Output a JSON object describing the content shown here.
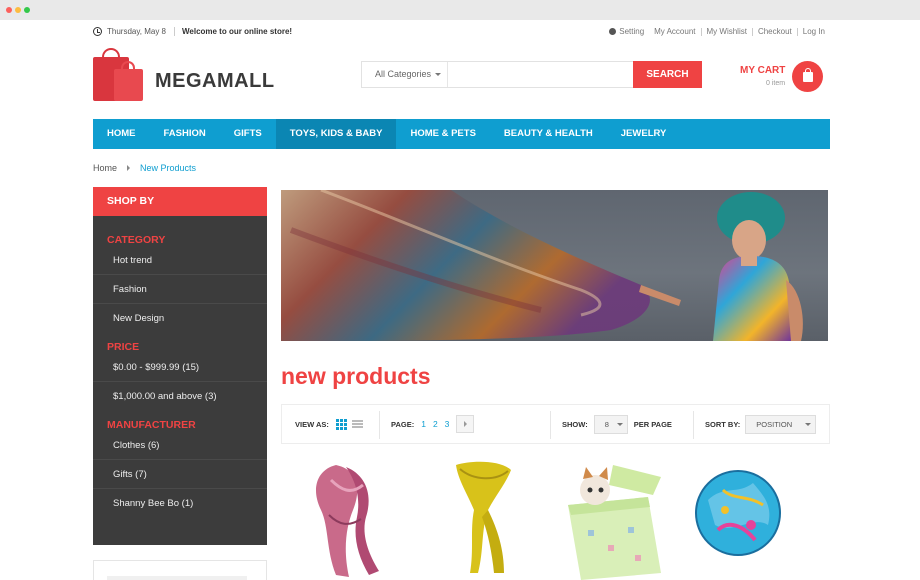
{
  "topbar": {
    "date": "Thursday, May 8",
    "welcome": "Welcome to our online store!",
    "links": [
      "Setting",
      "My Account",
      "My Wishlist",
      "Checkout",
      "Log In"
    ]
  },
  "logo": {
    "text": "MEGAMALL"
  },
  "search": {
    "category": "All Categories",
    "button": "SEARCH",
    "value": ""
  },
  "cart": {
    "label": "MY CART",
    "items": "0 item"
  },
  "nav": [
    "HOME",
    "FASHION",
    "GIFTS",
    "TOYS, KIDS & BABY",
    "HOME & PETS",
    "BEAUTY & HEALTH",
    "JEWELRY"
  ],
  "nav_active": "TOYS, KIDS & BABY",
  "breadcrumb": {
    "home": "Home",
    "current": "New Products"
  },
  "sidebar": {
    "title": "SHOP BY",
    "category": {
      "heading": "CATEGORY",
      "items": [
        "Hot trend",
        "Fashion",
        "New Design"
      ]
    },
    "price": {
      "heading": "PRICE",
      "items": [
        "$0.00 - $999.99 (15)",
        "$1,000.00 and above (3)"
      ]
    },
    "manufacturer": {
      "heading": "MANUFACTURER",
      "items": [
        "Clothes (6)",
        "Gifts (7)",
        "Shanny Bee Bo (1)"
      ]
    }
  },
  "page_title": "new products",
  "toolbar": {
    "view_label": "VIEW AS:",
    "page_label": "PAGE:",
    "pages": [
      "1",
      "2",
      "3"
    ],
    "show_label": "SHOW:",
    "show_value": "8",
    "per_page": "PER PAGE",
    "sort_label": "SORT BY:",
    "sort_value": "POSITION"
  },
  "colors": {
    "accent": "#ef4343",
    "nav": "#0f9ed0",
    "sidebar": "#3c3c3c"
  }
}
